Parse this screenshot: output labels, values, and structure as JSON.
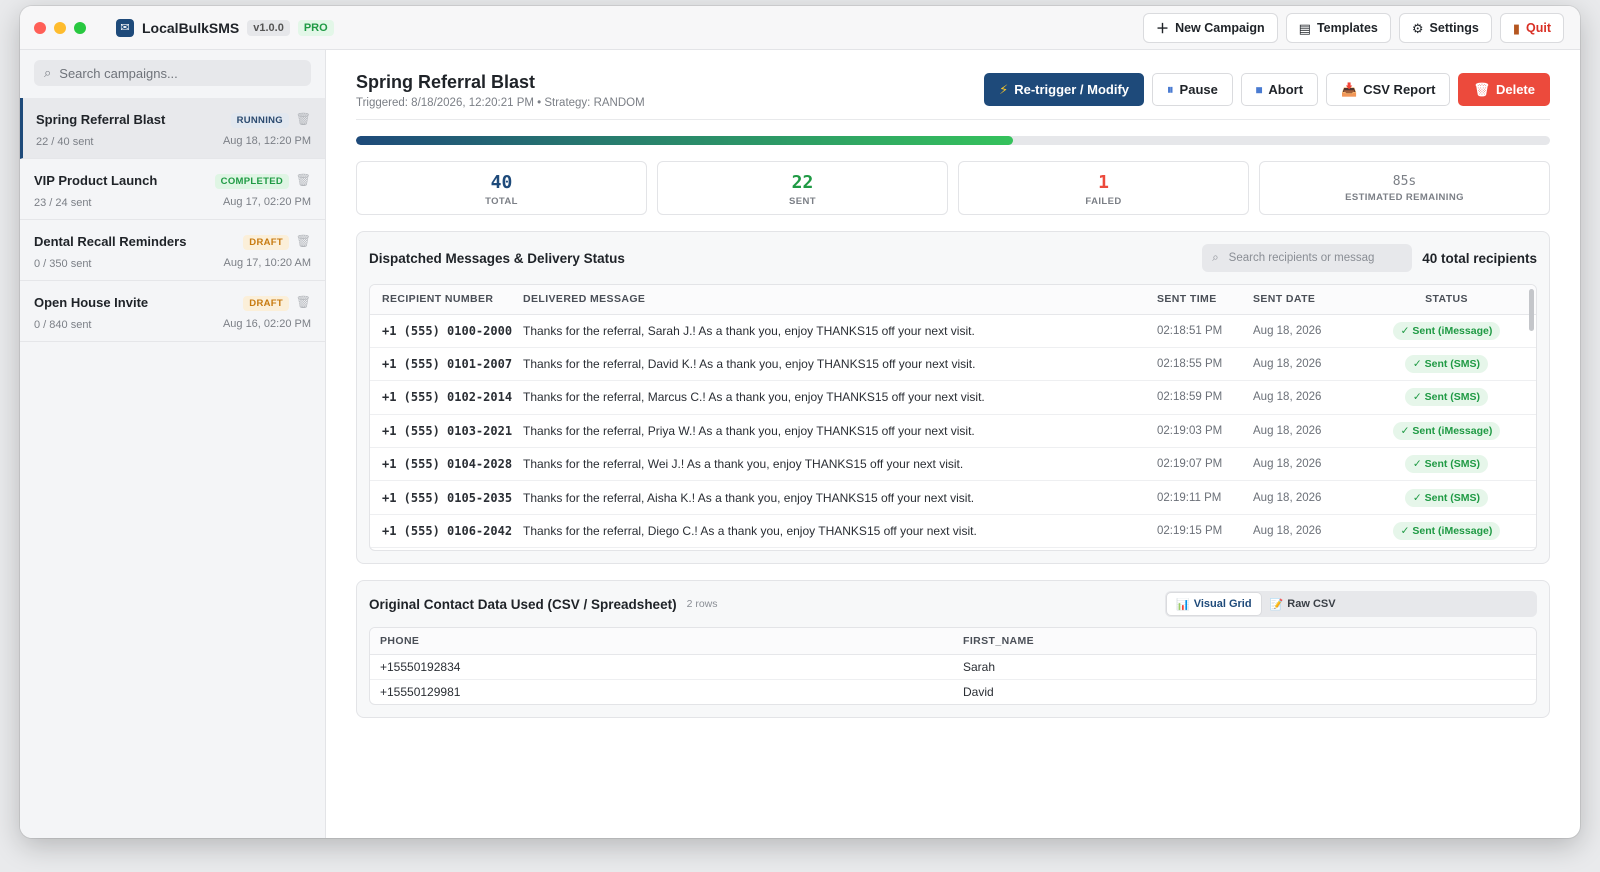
{
  "app": {
    "name": "LocalBulkSMS",
    "version": "v1.0.0",
    "tier": "PRO"
  },
  "toolbar": {
    "new_campaign": "New Campaign",
    "templates": "Templates",
    "settings": "Settings",
    "quit": "Quit"
  },
  "sidebar": {
    "search_placeholder": "Search campaigns...",
    "campaigns": [
      {
        "name": "Spring Referral Blast",
        "status": "RUNNING",
        "sent": "22 / 40 sent",
        "date": "Aug 18, 12:20 PM"
      },
      {
        "name": "VIP Product Launch",
        "status": "COMPLETED",
        "sent": "23 / 24 sent",
        "date": "Aug 17, 02:20 PM"
      },
      {
        "name": "Dental Recall Reminders",
        "status": "DRAFT",
        "sent": "0 / 350 sent",
        "date": "Aug 17, 10:20 AM"
      },
      {
        "name": "Open House Invite",
        "status": "DRAFT",
        "sent": "0 / 840 sent",
        "date": "Aug 16, 02:20 PM"
      }
    ]
  },
  "campaign": {
    "title": "Spring Referral Blast",
    "subtitle": "Triggered: 8/18/2026, 12:20:21 PM • Strategy: RANDOM",
    "actions": {
      "retrigger": "Re-trigger / Modify",
      "pause": "Pause",
      "abort": "Abort",
      "csv_report": "CSV Report",
      "delete": "Delete"
    },
    "progress_fraction": 0.55,
    "stats": {
      "total": "40",
      "total_label": "TOTAL",
      "sent": "22",
      "sent_label": "SENT",
      "failed": "1",
      "failed_label": "FAILED",
      "remaining": "85s",
      "remaining_label": "ESTIMATED REMAINING"
    }
  },
  "messages": {
    "title": "Dispatched Messages & Delivery Status",
    "search_placeholder": "Search recipients or messag",
    "total_label": "40 total recipients",
    "columns": {
      "recipient": "RECIPIENT NUMBER",
      "message": "DELIVERED MESSAGE",
      "time": "SENT TIME",
      "date": "SENT DATE",
      "status": "STATUS"
    },
    "rows": [
      {
        "number": "+1 (555) 0100-2000",
        "message": "Thanks for the referral, Sarah J.! As a thank you, enjoy THANKS15 off your next visit.",
        "time": "02:18:51 PM",
        "date": "Aug 18, 2026",
        "status": "✓ Sent (iMessage)"
      },
      {
        "number": "+1 (555) 0101-2007",
        "message": "Thanks for the referral, David K.! As a thank you, enjoy THANKS15 off your next visit.",
        "time": "02:18:55 PM",
        "date": "Aug 18, 2026",
        "status": "✓ Sent (SMS)"
      },
      {
        "number": "+1 (555) 0102-2014",
        "message": "Thanks for the referral, Marcus C.! As a thank you, enjoy THANKS15 off your next visit.",
        "time": "02:18:59 PM",
        "date": "Aug 18, 2026",
        "status": "✓ Sent (SMS)"
      },
      {
        "number": "+1 (555) 0103-2021",
        "message": "Thanks for the referral, Priya W.! As a thank you, enjoy THANKS15 off your next visit.",
        "time": "02:19:03 PM",
        "date": "Aug 18, 2026",
        "status": "✓ Sent (iMessage)"
      },
      {
        "number": "+1 (555) 0104-2028",
        "message": "Thanks for the referral, Wei J.! As a thank you, enjoy THANKS15 off your next visit.",
        "time": "02:19:07 PM",
        "date": "Aug 18, 2026",
        "status": "✓ Sent (SMS)"
      },
      {
        "number": "+1 (555) 0105-2035",
        "message": "Thanks for the referral, Aisha K.! As a thank you, enjoy THANKS15 off your next visit.",
        "time": "02:19:11 PM",
        "date": "Aug 18, 2026",
        "status": "✓ Sent (SMS)"
      },
      {
        "number": "+1 (555) 0106-2042",
        "message": "Thanks for the referral, Diego C.! As a thank you, enjoy THANKS15 off your next visit.",
        "time": "02:19:15 PM",
        "date": "Aug 18, 2026",
        "status": "✓ Sent (iMessage)"
      }
    ]
  },
  "contacts": {
    "title": "Original Contact Data Used (CSV / Spreadsheet)",
    "rows_note": "2 rows",
    "tabs": {
      "grid": "Visual Grid",
      "raw": "Raw CSV"
    },
    "columns": {
      "phone": "PHONE",
      "first_name": "FIRST_NAME"
    },
    "rows": [
      {
        "phone": "+15550192834",
        "first_name": "Sarah"
      },
      {
        "phone": "+15550129981",
        "first_name": "David"
      }
    ]
  },
  "colors": {
    "accent": "#1e4a7a",
    "success": "#1f9a44",
    "danger": "#ec4a3c",
    "draft": "#c77a10"
  }
}
